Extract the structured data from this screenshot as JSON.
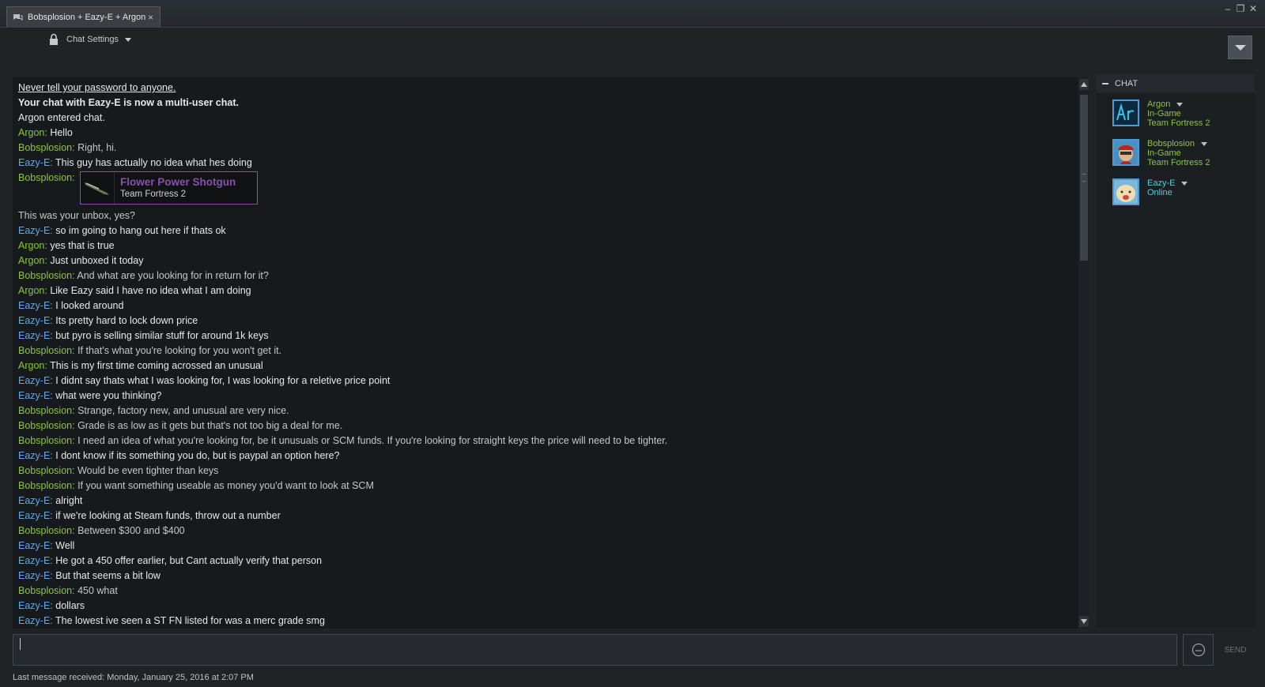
{
  "tab": {
    "title": "Bobsplosion + Eazy-E + Argon",
    "icon": "chat-bubble-icon",
    "close": "×"
  },
  "window_controls": {
    "minimize": "–",
    "maximize": "❐",
    "close": "✕"
  },
  "settings": {
    "label": "Chat Settings"
  },
  "log": {
    "notice": "Never tell your password to anyone.",
    "multi": "Your chat with Eazy-E is now a multi-user chat.",
    "entered": "Argon entered chat.",
    "messages": [
      {
        "s": "Argon: ",
        "t": "Hello"
      },
      {
        "s": "Bobsplosion: ",
        "t": "Right, hi."
      },
      {
        "s": "Eazy-E: ",
        "t": "This guy has actually no idea what hes doing"
      },
      {
        "s": "Bobsplosion: ",
        "t": ""
      },
      {
        "s": "",
        "t": "This was your unbox, yes?"
      },
      {
        "s": "Eazy-E: ",
        "t": "so im going to hang out here if thats ok"
      },
      {
        "s": "Argon: ",
        "t": "yes that is true"
      },
      {
        "s": "Argon: ",
        "t": "Just unboxed it today"
      },
      {
        "s": "Bobsplosion: ",
        "t": "And what are you looking for in return for it?"
      },
      {
        "s": "Argon: ",
        "t": "Like Eazy said I have no idea what I am doing"
      },
      {
        "s": "Eazy-E: ",
        "t": "I looked around"
      },
      {
        "s": "Eazy-E: ",
        "t": "Its pretty hard to lock down price"
      },
      {
        "s": "Eazy-E: ",
        "t": "but pyro is selling similar stuff for around 1k keys"
      },
      {
        "s": "Bobsplosion: ",
        "t": "If that's what you're looking for you won't get it."
      },
      {
        "s": "Argon: ",
        "t": "This is my first time coming acrossed an unusual"
      },
      {
        "s": "Eazy-E: ",
        "t": "I didnt say thats what I was looking for, I was looking for a reletive price point"
      },
      {
        "s": "Eazy-E: ",
        "t": "what were you thinking?"
      },
      {
        "s": "Bobsplosion: ",
        "t": "Strange, factory new, and unusual are very nice."
      },
      {
        "s": "Bobsplosion: ",
        "t": "Grade is as low as it gets but that's not too big a deal for me."
      },
      {
        "s": "Bobsplosion: ",
        "t": "I need an idea of what you're looking for, be it unusuals or SCM funds. If you're looking for straight keys the price will need to be tighter."
      },
      {
        "s": "Eazy-E: ",
        "t": "I dont know if its something you do, but is paypal an option here?"
      },
      {
        "s": "Bobsplosion: ",
        "t": "Would be even tighter than keys"
      },
      {
        "s": "Bobsplosion: ",
        "t": "If you want something useable as money you'd want to look at SCM"
      },
      {
        "s": "Eazy-E: ",
        "t": "alright"
      },
      {
        "s": "Eazy-E: ",
        "t": "if we're looking at Steam funds, throw out a number"
      },
      {
        "s": "Bobsplosion: ",
        "t": "Between $300 and $400"
      },
      {
        "s": "Eazy-E: ",
        "t": "Well"
      },
      {
        "s": "Eazy-E: ",
        "t": "He got a 450 offer earlier, but Cant actually verify that person"
      },
      {
        "s": "Eazy-E: ",
        "t": "But that seems a bit low"
      },
      {
        "s": "Bobsplosion: ",
        "t": "450 what"
      },
      {
        "s": "Eazy-E: ",
        "t": "dollars"
      },
      {
        "s": "Eazy-E: ",
        "t": "The lowest ive seen a ST FN listed for was a merc grade smg"
      }
    ],
    "item": {
      "name": "Flower Power Shotgun",
      "game": "Team Fortress 2",
      "color": "#8650ac"
    }
  },
  "panel": {
    "header": "CHAT",
    "members": [
      {
        "name": "Argon",
        "status": "In-Game",
        "game": "Team Fortress 2",
        "avatar": "ar-avatar-icon"
      },
      {
        "name": "Bobsplosion",
        "status": "In-Game",
        "game": "Team Fortress 2",
        "avatar": "pilot-avatar-icon"
      },
      {
        "name": "Eazy-E",
        "status": "Online",
        "game": "",
        "avatar": "blob-avatar-icon"
      }
    ]
  },
  "input": {
    "value": "",
    "send_label": "SEND"
  },
  "footer": {
    "text": "Last message received: Monday, January 25, 2016 at 2:07 PM"
  },
  "colors": {
    "ingame": "#8bc53f",
    "online": "#57cbde",
    "eazy": "#62a7e3",
    "item": "#8650ac"
  }
}
